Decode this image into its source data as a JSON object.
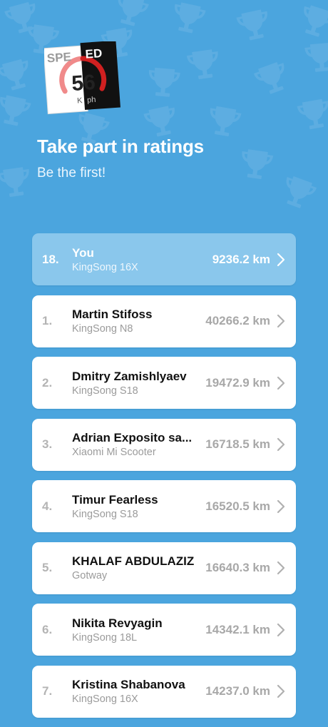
{
  "logo": {
    "left_text": "SPE",
    "right_text": "ED",
    "speed": "56",
    "unit_left": "K",
    "unit_right": "ph"
  },
  "header": {
    "title": "Take part in ratings",
    "subtitle": "Be the first!"
  },
  "ratings": [
    {
      "rank": "18.",
      "name": "You",
      "model": "KingSong 16X",
      "distance": "9236.2 km",
      "highlight": true
    },
    {
      "rank": "1.",
      "name": "Martin Stifoss",
      "model": "KingSong N8",
      "distance": "40266.2 km"
    },
    {
      "rank": "2.",
      "name": "Dmitry Zamishlyaev",
      "model": "KingSong S18",
      "distance": "19472.9 km"
    },
    {
      "rank": "3.",
      "name": "Adrian Exposito sa...",
      "model": "Xiaomi Mi Scooter",
      "distance": "16718.5 km"
    },
    {
      "rank": "4.",
      "name": "Timur Fearless",
      "model": "KingSong S18",
      "distance": "16520.5 km"
    },
    {
      "rank": "5.",
      "name": "KHALAF ABDULAZIZ",
      "model": "Gotway",
      "distance": "16640.3 km"
    },
    {
      "rank": "6.",
      "name": "Nikita Revyagin",
      "model": "KingSong 18L",
      "distance": "14342.1 km"
    },
    {
      "rank": "7.",
      "name": "Kristina Shabanova",
      "model": "KingSong 16X",
      "distance": "14237.0 km"
    }
  ],
  "colors": {
    "background": "#4ba5de",
    "highlight_row": "#8ac7ec",
    "card": "#ffffff"
  },
  "icons": {
    "row_action": "chevron-right-icon",
    "background_pattern": "trophy-icon"
  }
}
